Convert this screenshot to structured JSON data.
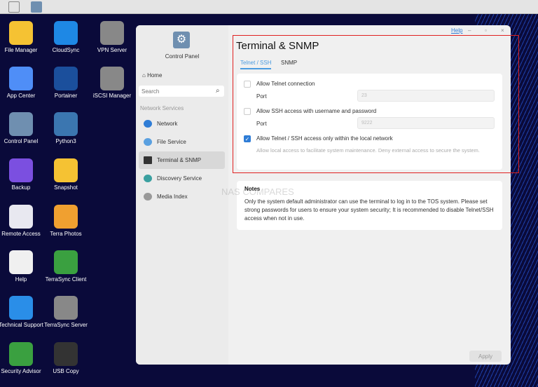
{
  "taskbar": {
    "items": [
      "windows-icon",
      "control-panel-icon"
    ]
  },
  "desktop": {
    "icons": [
      {
        "label": "File Manager",
        "color": "#f5c233"
      },
      {
        "label": "CloudSync",
        "color": "#1e88e5"
      },
      {
        "label": "VPN Server",
        "color": "#888888"
      },
      {
        "label": "App Center",
        "color": "#4f8ef7"
      },
      {
        "label": "Portainer",
        "color": "#1b4f9c"
      },
      {
        "label": "iSCSI Manager",
        "color": "#888888"
      },
      {
        "label": "Control Panel",
        "color": "#6f8fb0"
      },
      {
        "label": "Python3",
        "color": "#3b76b0"
      },
      {
        "label": "Backup",
        "color": "#7b4fe0"
      },
      {
        "label": "Snapshot",
        "color": "#f5c233"
      },
      {
        "label": "Remote Access",
        "color": "#e8e8f0"
      },
      {
        "label": "Terra Photos",
        "color": "#f0a030"
      },
      {
        "label": "Help",
        "color": "#f0f0f0"
      },
      {
        "label": "TerraSync Client",
        "color": "#3aa040"
      },
      {
        "label": "Technical Support",
        "color": "#2a8ee8"
      },
      {
        "label": "TerraSync Server",
        "color": "#888888"
      },
      {
        "label": "Security Advisor",
        "color": "#3aa040"
      },
      {
        "label": "USB Copy",
        "color": "#333333"
      }
    ]
  },
  "window": {
    "help": "Help",
    "sidebar": {
      "app_title": "Control Panel",
      "home": "Home",
      "search_placeholder": "Search",
      "section": "Network Services",
      "items": [
        {
          "label": "Network",
          "color": "#2f7dd6"
        },
        {
          "label": "File Service",
          "color": "#5aa0e0"
        },
        {
          "label": "Terminal & SNMP",
          "color": "#333333"
        },
        {
          "label": "Discovery Service",
          "color": "#3aa0a0"
        },
        {
          "label": "Media Index",
          "color": "#999999"
        }
      ]
    },
    "title": "Terminal & SNMP",
    "tabs": [
      "Telnet / SSH",
      "SNMP"
    ],
    "settings": {
      "telnet_label": "Allow Telnet connection",
      "telnet_checked": false,
      "port_label": "Port",
      "telnet_port": "23",
      "ssh_label": "Allow SSH access with username and password",
      "ssh_checked": false,
      "ssh_port": "9222",
      "local_label": "Allow Telnet / SSH access only within the local network",
      "local_checked": true,
      "local_desc": "Allow local access to facilitate system maintenance. Deny external access to secure the system."
    },
    "notes": {
      "title": "Notes",
      "text": "Only the system default administrator can use the terminal to log in to the TOS system. Please set strong passwords for users to ensure your system security; It is recommended to disable Telnet/SSH access when not in use."
    },
    "apply": "Apply",
    "watermark": "NAS COMPARES"
  }
}
